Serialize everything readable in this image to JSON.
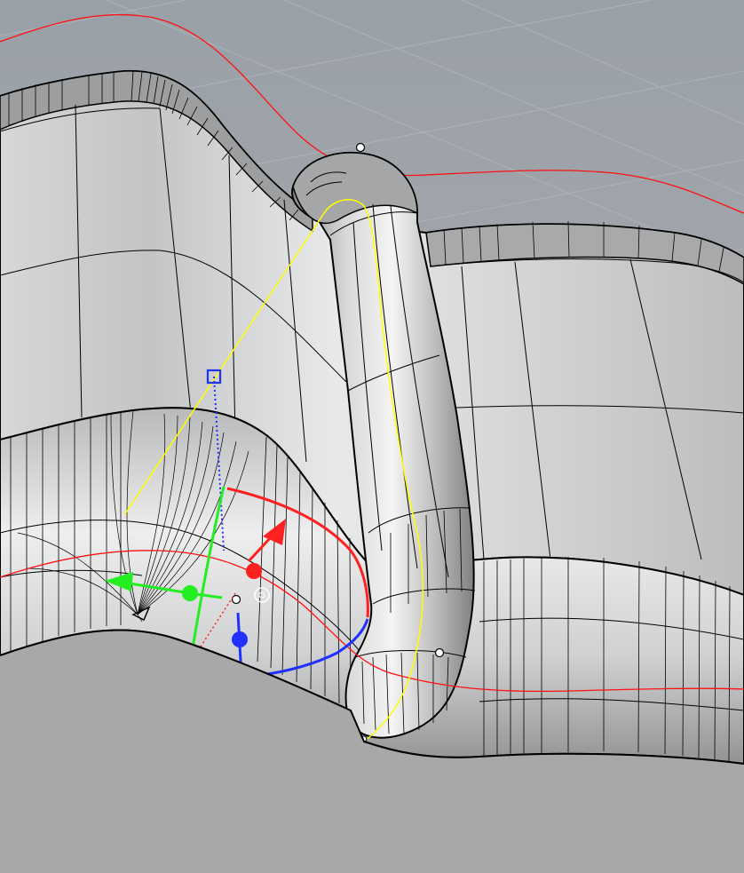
{
  "viewport": {
    "view": "perspective-3d",
    "colors": {
      "background_top": "#9ea4ab",
      "background_floor": "#a9a9a9",
      "grid_line": "#b3b8bd",
      "surface_light": "#e9eaeb",
      "surface_mid": "#c8c9ca",
      "surface_dark": "#8f9091",
      "isocurve": "#000000",
      "red_curve": "#ff0000",
      "selected_curve": "#ffff00",
      "gumball_x": "#ff2020",
      "gumball_y": "#22ee22",
      "gumball_z": "#2030ff",
      "control_point": "#ffffff"
    }
  },
  "scene": {
    "objects": [
      "sofa-back-surface",
      "sofa-seat-surface",
      "tube-armrest-surface",
      "red-section-curve",
      "yellow-rail-curve"
    ],
    "control_points": 4
  },
  "gumball": {
    "axes": [
      "x",
      "y",
      "z"
    ],
    "handles": [
      "move-arrow",
      "rotate-arc",
      "scale-dot",
      "plane-square"
    ]
  }
}
